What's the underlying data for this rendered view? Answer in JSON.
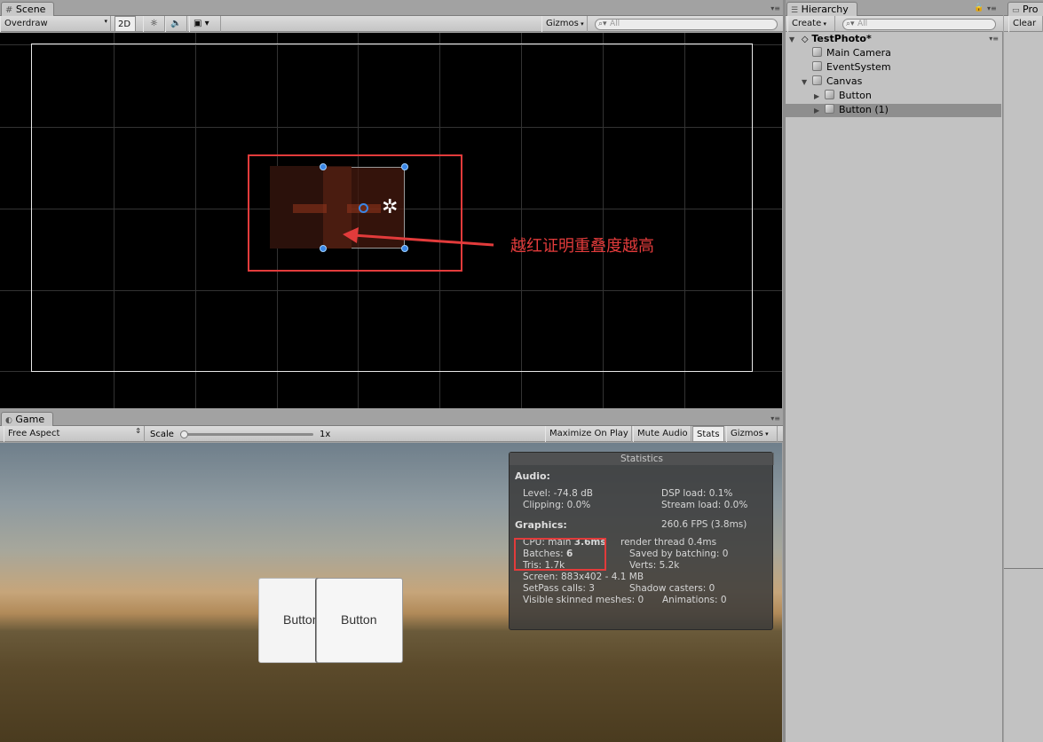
{
  "scene": {
    "tab_label": "Scene",
    "draw_mode": "Overdraw",
    "mode_2d": "2D",
    "gizmos_label": "Gizmos",
    "search_placeholder": "All",
    "annotation": "越红证明重叠度越高"
  },
  "hierarchy": {
    "tab_label": "Hierarchy",
    "create_label": "Create",
    "search_placeholder": "All",
    "scene_name": "TestPhoto*",
    "items": [
      {
        "label": "Main Camera",
        "depth": 1,
        "expandable": false,
        "selected": false
      },
      {
        "label": "EventSystem",
        "depth": 1,
        "expandable": false,
        "selected": false
      },
      {
        "label": "Canvas",
        "depth": 1,
        "expandable": true,
        "expanded": true,
        "selected": false
      },
      {
        "label": "Button",
        "depth": 2,
        "expandable": true,
        "expanded": false,
        "selected": false
      },
      {
        "label": "Button (1)",
        "depth": 2,
        "expandable": true,
        "expanded": false,
        "selected": true
      }
    ]
  },
  "project": {
    "tab_label": "Pro",
    "clear_label": "Clear"
  },
  "game": {
    "tab_label": "Game",
    "aspect": "Free Aspect",
    "scale_label": "Scale",
    "scale_value": "1x",
    "scale_level": 0,
    "maximize_label": "Maximize On Play",
    "mute_label": "Mute Audio",
    "stats_label": "Stats",
    "gizmos_label": "Gizmos",
    "button_left_label": "Button",
    "button_right_label": "Button"
  },
  "stats": {
    "title": "Statistics",
    "audio_heading": "Audio:",
    "level": "Level: -74.8 dB",
    "clipping": "Clipping: 0.0%",
    "dsp_load": "DSP load: 0.1%",
    "stream_load": "Stream load: 0.0%",
    "graphics_heading": "Graphics:",
    "fps": "260.6 FPS (3.8ms)",
    "cpu_prefix": "CPU: main ",
    "cpu_main": "3.6ms",
    "render_thread": "render thread 0.4ms",
    "batches_prefix": "Batches: ",
    "batches": "6",
    "saved_batching": "Saved by batching: 0",
    "tris": "Tris: 1.7k",
    "verts": "Verts: 5.2k",
    "screen": "Screen: 883x402 - 4.1 MB",
    "setpass": "SetPass calls: 3",
    "shadow_casters": "Shadow casters: 0",
    "skinned": "Visible skinned meshes: 0",
    "animations": "Animations: 0"
  },
  "colors": {
    "highlight_red": "#e23b3b",
    "selection_blue": "#3a86e6",
    "panel_gray": "#c2c2c2"
  }
}
